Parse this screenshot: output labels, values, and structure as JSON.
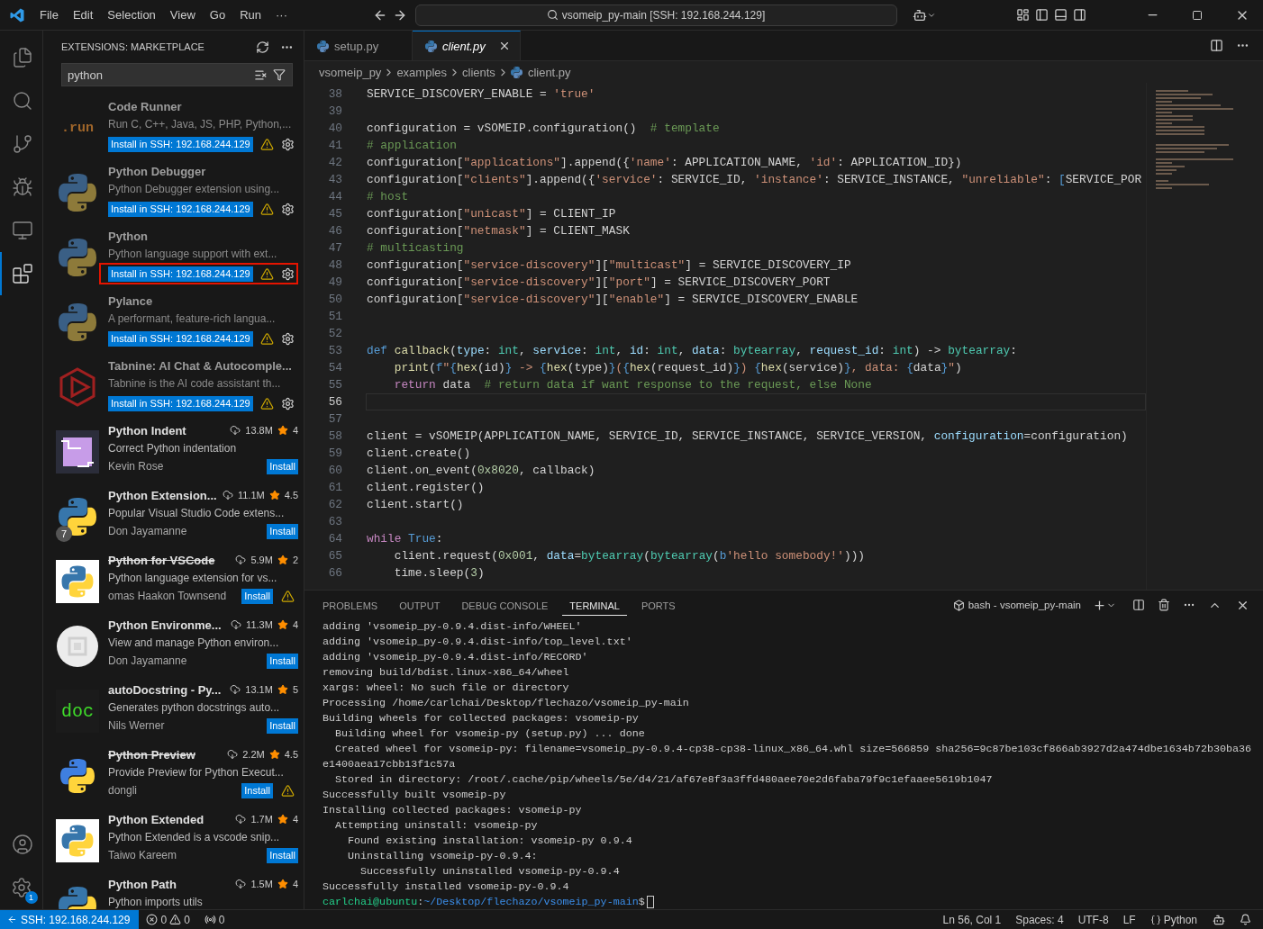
{
  "title_bar": {
    "menu": [
      "File",
      "Edit",
      "Selection",
      "View",
      "Go",
      "Run",
      "···"
    ],
    "search": "vsomeip_py-main [SSH: 192.168.244.129]"
  },
  "activity_bar": {
    "items": [
      {
        "selected": false
      },
      {
        "selected": false
      },
      {
        "selected": false
      },
      {
        "selected": false
      },
      {
        "selected": false
      },
      {
        "selected": true
      }
    ],
    "settings_badge": "1"
  },
  "sidebar": {
    "title": "EXTENSIONS: MARKETPLACE",
    "search": "python",
    "extensions": [
      {
        "kind": "remote",
        "icon_text": ".run",
        "name": "Code Runner",
        "description": "Run C, C++, Java, JS, PHP, Python,...",
        "action": "Install in SSH: 192.168.244.129",
        "highlighted": false
      },
      {
        "kind": "remote",
        "name": "Python Debugger",
        "description": "Python Debugger extension using...",
        "action": "Install in SSH: 192.168.244.129",
        "highlighted": false
      },
      {
        "kind": "remote",
        "name": "Python",
        "description": "Python language support with ext...",
        "action": "Install in SSH: 192.168.244.129",
        "highlighted": true
      },
      {
        "kind": "remote",
        "name": "Pylance",
        "description": "A performant, feature-rich langua...",
        "action": "Install in SSH: 192.168.244.129",
        "highlighted": false
      },
      {
        "kind": "remote",
        "name": "Tabnine: AI Chat & Autocomple...",
        "description": "Tabnine is the AI code assistant th...",
        "action": "Install in SSH: 192.168.244.129",
        "highlighted": false
      },
      {
        "kind": "market",
        "name": "Python Indent",
        "downloads": "13.8M",
        "rating": "4",
        "description": "Correct Python indentation",
        "author": "Kevin Rose",
        "action": "Install",
        "deprecated": false,
        "warning": false
      },
      {
        "kind": "market",
        "badge": "7",
        "name": "Python Extension...",
        "downloads": "11.1M",
        "rating": "4.5",
        "description": "Popular Visual Studio Code extens...",
        "author": "Don Jayamanne",
        "action": "Install",
        "deprecated": false,
        "warning": false
      },
      {
        "kind": "market",
        "name": "Python for VSCode",
        "downloads": "5.9M",
        "rating": "2",
        "description": "Python language extension for vs...",
        "author": "omas Haakon Townsend",
        "action": "Install",
        "deprecated": true,
        "warning": true
      },
      {
        "kind": "market",
        "name": "Python Environme...",
        "downloads": "11.3M",
        "rating": "4",
        "description": "View and manage Python environ...",
        "author": "Don Jayamanne",
        "action": "Install",
        "deprecated": false,
        "warning": false
      },
      {
        "kind": "market",
        "icon_text": "doc",
        "name": "autoDocstring - Py...",
        "downloads": "13.1M",
        "rating": "5",
        "description": "Generates python docstrings auto...",
        "author": "Nils Werner",
        "action": "Install",
        "deprecated": false,
        "warning": false
      },
      {
        "kind": "market",
        "name": "Python Preview",
        "downloads": "2.2M",
        "rating": "4.5",
        "description": "Provide Preview for Python Execut...",
        "author": "dongli",
        "action": "Install",
        "deprecated": true,
        "warning": true
      },
      {
        "kind": "market",
        "name": "Python Extended",
        "downloads": "1.7M",
        "rating": "4",
        "description": "Python Extended is a vscode snip...",
        "author": "Taiwo Kareem",
        "action": "Install",
        "deprecated": false,
        "warning": false
      },
      {
        "kind": "market",
        "name": "Python Path",
        "downloads": "1.5M",
        "rating": "4",
        "description": "Python imports utils",
        "deprecated": false,
        "warning": false
      }
    ]
  },
  "editor": {
    "tabs": [
      {
        "label": "setup.py",
        "selected": false,
        "preview": false
      },
      {
        "label": "client.py",
        "selected": true,
        "preview": true
      }
    ],
    "breadcrumb": [
      "vsomeip_py",
      "examples",
      "clients",
      "client.py"
    ],
    "lines": [
      {
        "number": "38",
        "current": false,
        "tokens": [
          {
            "kind": "plain",
            "text": "SERVICE_DISCOVERY_ENABLE = "
          },
          {
            "kind": "str",
            "text": "'true'"
          }
        ]
      },
      {
        "number": "39",
        "current": false
      },
      {
        "number": "40",
        "current": false,
        "tokens": [
          {
            "kind": "plain",
            "text": "configuration = vSOMEIP.configuration()  "
          },
          {
            "kind": "com",
            "text": "# template"
          }
        ]
      },
      {
        "number": "41",
        "current": false,
        "tokens": [
          {
            "kind": "com",
            "text": "# application"
          }
        ]
      },
      {
        "number": "42",
        "current": false,
        "tokens": [
          {
            "kind": "plain",
            "text": "configuration["
          },
          {
            "kind": "str",
            "text": "\"applications\""
          },
          {
            "kind": "plain",
            "text": "].append({"
          },
          {
            "kind": "str",
            "text": "'name'"
          },
          {
            "kind": "plain",
            "text": ": APPLICATION_NAME, "
          },
          {
            "kind": "str",
            "text": "'id'"
          },
          {
            "kind": "plain",
            "text": ": APPLICATION_ID})"
          }
        ]
      },
      {
        "number": "43",
        "current": false,
        "tokens": [
          {
            "kind": "plain",
            "text": "configuration["
          },
          {
            "kind": "str",
            "text": "\"clients\""
          },
          {
            "kind": "plain",
            "text": "].append({"
          },
          {
            "kind": "str",
            "text": "'service'"
          },
          {
            "kind": "plain",
            "text": ": SERVICE_ID, "
          },
          {
            "kind": "str",
            "text": "'instance'"
          },
          {
            "kind": "plain",
            "text": ": SERVICE_INSTANCE, "
          },
          {
            "kind": "str",
            "text": "\"unreliable\""
          },
          {
            "kind": "plain",
            "text": ": "
          },
          {
            "kind": "kw",
            "text": "["
          },
          {
            "kind": "plain",
            "text": "SERVICE_POR"
          }
        ]
      },
      {
        "number": "44",
        "current": false,
        "tokens": [
          {
            "kind": "com",
            "text": "# host"
          }
        ]
      },
      {
        "number": "45",
        "current": false,
        "tokens": [
          {
            "kind": "plain",
            "text": "configuration["
          },
          {
            "kind": "str",
            "text": "\"unicast\""
          },
          {
            "kind": "plain",
            "text": "] = CLIENT_IP"
          }
        ]
      },
      {
        "number": "46",
        "current": false,
        "tokens": [
          {
            "kind": "plain",
            "text": "configuration["
          },
          {
            "kind": "str",
            "text": "\"netmask\""
          },
          {
            "kind": "plain",
            "text": "] = CLIENT_MASK"
          }
        ]
      },
      {
        "number": "47",
        "current": false,
        "tokens": [
          {
            "kind": "com",
            "text": "# multicasting"
          }
        ]
      },
      {
        "number": "48",
        "current": false,
        "tokens": [
          {
            "kind": "plain",
            "text": "configuration["
          },
          {
            "kind": "str",
            "text": "\"service-discovery\""
          },
          {
            "kind": "plain",
            "text": "]["
          },
          {
            "kind": "str",
            "text": "\"multicast\""
          },
          {
            "kind": "plain",
            "text": "] = SERVICE_DISCOVERY_IP"
          }
        ]
      },
      {
        "number": "49",
        "current": false,
        "tokens": [
          {
            "kind": "plain",
            "text": "configuration["
          },
          {
            "kind": "str",
            "text": "\"service-discovery\""
          },
          {
            "kind": "plain",
            "text": "]["
          },
          {
            "kind": "str",
            "text": "\"port\""
          },
          {
            "kind": "plain",
            "text": "] = SERVICE_DISCOVERY_PORT"
          }
        ]
      },
      {
        "number": "50",
        "current": false,
        "tokens": [
          {
            "kind": "plain",
            "text": "configuration["
          },
          {
            "kind": "str",
            "text": "\"service-discovery\""
          },
          {
            "kind": "plain",
            "text": "]["
          },
          {
            "kind": "str",
            "text": "\"enable\""
          },
          {
            "kind": "plain",
            "text": "] = SERVICE_DISCOVERY_ENABLE"
          }
        ]
      },
      {
        "number": "51",
        "current": false
      },
      {
        "number": "52",
        "current": false
      },
      {
        "number": "53",
        "current": false,
        "tokens": [
          {
            "kind": "kw",
            "text": "def"
          },
          {
            "kind": "fn",
            "text": " callback"
          },
          {
            "kind": "plain",
            "text": "("
          },
          {
            "kind": "param",
            "text": "type"
          },
          {
            "kind": "plain",
            "text": ": "
          },
          {
            "kind": "type",
            "text": "int"
          },
          {
            "kind": "plain",
            "text": ", "
          },
          {
            "kind": "param",
            "text": "service"
          },
          {
            "kind": "plain",
            "text": ": "
          },
          {
            "kind": "type",
            "text": "int"
          },
          {
            "kind": "plain",
            "text": ", "
          },
          {
            "kind": "param",
            "text": "id"
          },
          {
            "kind": "plain",
            "text": ": "
          },
          {
            "kind": "type",
            "text": "int"
          },
          {
            "kind": "plain",
            "text": ", "
          },
          {
            "kind": "param",
            "text": "data"
          },
          {
            "kind": "plain",
            "text": ": "
          },
          {
            "kind": "type",
            "text": "bytearray"
          },
          {
            "kind": "plain",
            "text": ", "
          },
          {
            "kind": "param",
            "text": "request_id"
          },
          {
            "kind": "plain",
            "text": ": "
          },
          {
            "kind": "type",
            "text": "int"
          },
          {
            "kind": "plain",
            "text": ") -> "
          },
          {
            "kind": "type",
            "text": "bytearray"
          },
          {
            "kind": "plain",
            "text": ":"
          }
        ]
      },
      {
        "number": "54",
        "current": false,
        "tokens": [
          {
            "kind": "fn",
            "text": "    print"
          },
          {
            "kind": "plain",
            "text": "("
          },
          {
            "kind": "kw",
            "text": "f"
          },
          {
            "kind": "str",
            "text": "\""
          },
          {
            "kind": "kw",
            "text": "{"
          },
          {
            "kind": "fn",
            "text": "hex"
          },
          {
            "kind": "plain",
            "text": "(id)"
          },
          {
            "kind": "kw",
            "text": "}"
          },
          {
            "kind": "str",
            "text": " -> "
          },
          {
            "kind": "kw",
            "text": "{"
          },
          {
            "kind": "fn",
            "text": "hex"
          },
          {
            "kind": "plain",
            "text": "(type)"
          },
          {
            "kind": "kw",
            "text": "}"
          },
          {
            "kind": "str",
            "text": "("
          },
          {
            "kind": "kw",
            "text": "{"
          },
          {
            "kind": "fn",
            "text": "hex"
          },
          {
            "kind": "plain",
            "text": "(request_id)"
          },
          {
            "kind": "kw",
            "text": "}"
          },
          {
            "kind": "str",
            "text": ") "
          },
          {
            "kind": "kw",
            "text": "{"
          },
          {
            "kind": "fn",
            "text": "hex"
          },
          {
            "kind": "plain",
            "text": "(service)"
          },
          {
            "kind": "kw",
            "text": "}"
          },
          {
            "kind": "str",
            "text": ", data: "
          },
          {
            "kind": "kw",
            "text": "{"
          },
          {
            "kind": "plain",
            "text": "data"
          },
          {
            "kind": "kw",
            "text": "}"
          },
          {
            "kind": "str",
            "text": "\""
          },
          {
            "kind": "plain",
            "text": ")"
          }
        ]
      },
      {
        "number": "55",
        "current": false,
        "tokens": [
          {
            "kind": "ctrl",
            "text": "    return"
          },
          {
            "kind": "plain",
            "text": " data  "
          },
          {
            "kind": "com",
            "text": "# return data if want response to the request, else None"
          }
        ]
      },
      {
        "number": "56",
        "current": true
      },
      {
        "number": "57",
        "current": false
      },
      {
        "number": "58",
        "current": false,
        "tokens": [
          {
            "kind": "plain",
            "text": "client = vSOMEIP(APPLICATION_NAME, SERVICE_ID, SERVICE_INSTANCE, SERVICE_VERSION, "
          },
          {
            "kind": "param",
            "text": "configuration"
          },
          {
            "kind": "plain",
            "text": "=configuration)"
          }
        ]
      },
      {
        "number": "59",
        "current": false,
        "tokens": [
          {
            "kind": "plain",
            "text": "client.create()"
          }
        ]
      },
      {
        "number": "60",
        "current": false,
        "tokens": [
          {
            "kind": "plain",
            "text": "client.on_event("
          },
          {
            "kind": "num",
            "text": "0x8020"
          },
          {
            "kind": "plain",
            "text": ", callback)"
          }
        ]
      },
      {
        "number": "61",
        "current": false,
        "tokens": [
          {
            "kind": "plain",
            "text": "client.register()"
          }
        ]
      },
      {
        "number": "62",
        "current": false,
        "tokens": [
          {
            "kind": "plain",
            "text": "client.start()"
          }
        ]
      },
      {
        "number": "63",
        "current": false
      },
      {
        "number": "64",
        "current": false,
        "tokens": [
          {
            "kind": "ctrl",
            "text": "while"
          },
          {
            "kind": "kw",
            "text": " True"
          },
          {
            "kind": "plain",
            "text": ":"
          }
        ]
      },
      {
        "number": "65",
        "current": false,
        "tokens": [
          {
            "kind": "plain",
            "text": "    client.request("
          },
          {
            "kind": "num",
            "text": "0x001"
          },
          {
            "kind": "plain",
            "text": ", "
          },
          {
            "kind": "param",
            "text": "data"
          },
          {
            "kind": "plain",
            "text": "="
          },
          {
            "kind": "type",
            "text": "bytearray"
          },
          {
            "kind": "plain",
            "text": "("
          },
          {
            "kind": "type",
            "text": "bytearray"
          },
          {
            "kind": "plain",
            "text": "("
          },
          {
            "kind": "kw",
            "text": "b"
          },
          {
            "kind": "str",
            "text": "'hello somebody!'"
          },
          {
            "kind": "plain",
            "text": ")))"
          }
        ]
      },
      {
        "number": "66",
        "current": false,
        "tokens": [
          {
            "kind": "plain",
            "text": "    time.sleep("
          },
          {
            "kind": "num",
            "text": "3"
          },
          {
            "kind": "plain",
            "text": ")"
          }
        ]
      }
    ]
  },
  "panel": {
    "tabs": [
      {
        "label": "PROBLEMS",
        "selected": false
      },
      {
        "label": "OUTPUT",
        "selected": false
      },
      {
        "label": "DEBUG CONSOLE",
        "selected": false
      },
      {
        "label": "TERMINAL",
        "selected": true
      },
      {
        "label": "PORTS",
        "selected": false
      }
    ],
    "terminal_name": "bash - vsomeip_py-main",
    "lines": [
      "adding 'vsomeip_py-0.9.4.dist-info/WHEEL'",
      "adding 'vsomeip_py-0.9.4.dist-info/top_level.txt'",
      "adding 'vsomeip_py-0.9.4.dist-info/RECORD'",
      "removing build/bdist.linux-x86_64/wheel",
      "xargs: wheel: No such file or directory",
      "Processing /home/carlchai/Desktop/flechazo/vsomeip_py-main",
      "Building wheels for collected packages: vsomeip-py",
      "  Building wheel for vsomeip-py (setup.py) ... done",
      "  Created wheel for vsomeip-py: filename=vsomeip_py-0.9.4-cp38-cp38-linux_x86_64.whl size=566859 sha256=9c87be103cf866ab3927d2a474dbe1634b72b30ba36",
      "e1400aea17cbb13f1c57a",
      "  Stored in directory: /root/.cache/pip/wheels/5e/d4/21/af67e8f3a3ffd480aee70e2d6faba79f9c1efaaee5619b1047",
      "Successfully built vsomeip-py",
      "Installing collected packages: vsomeip-py",
      "  Attempting uninstall: vsomeip-py",
      "    Found existing installation: vsomeip-py 0.9.4",
      "    Uninstalling vsomeip-py-0.9.4:",
      "      Successfully uninstalled vsomeip-py-0.9.4",
      "Successfully installed vsomeip-py-0.9.4"
    ],
    "prompt": {
      "user": "carlchai@ubuntu",
      "separator": ":",
      "path": "~/Desktop/flechazo/vsomeip_py-main",
      "symbol": "$"
    }
  },
  "status_bar": {
    "remote": "SSH: 192.168.244.129",
    "errors": "0",
    "warnings": "0",
    "ports": "0",
    "position": "Ln 56, Col 1",
    "indent": "Spaces: 4",
    "encoding": "UTF-8",
    "eol": "LF",
    "language": "Python"
  }
}
